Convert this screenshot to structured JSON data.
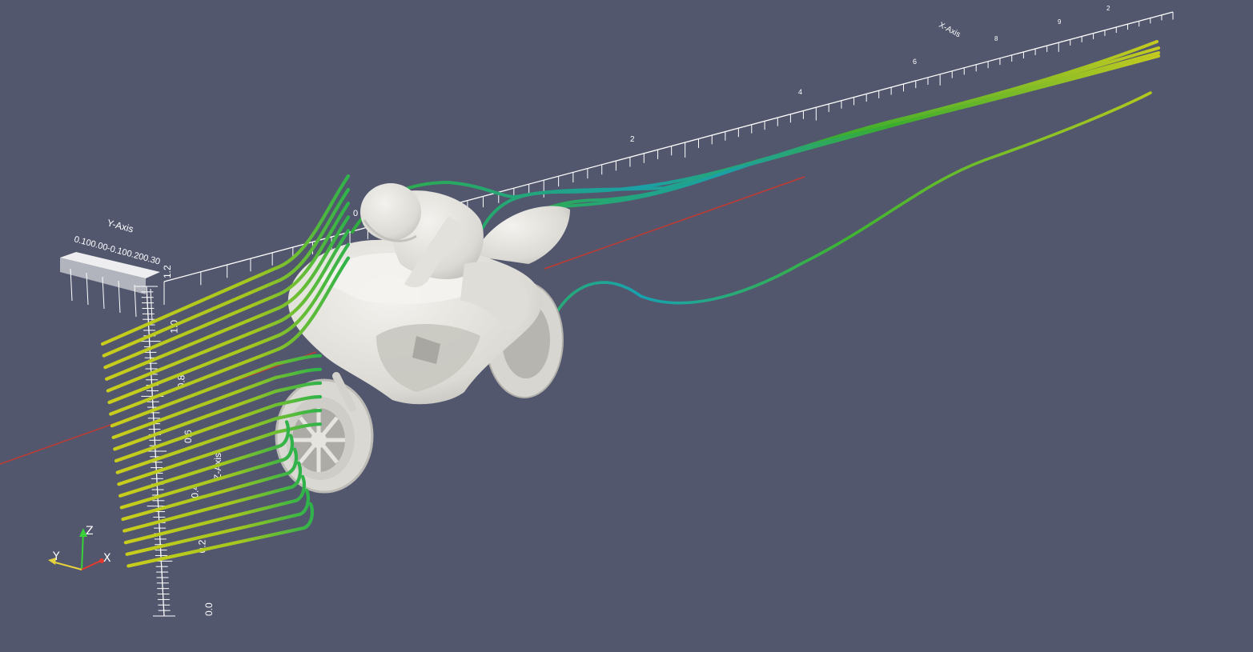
{
  "viewport": {
    "background": "#52576e",
    "model_color": "#e9e7e2",
    "x_axis_line_color": "#c23a30"
  },
  "axes": {
    "x_axis": {
      "title": "X-Axis",
      "tick_labels": [
        "0",
        "2",
        "4",
        "6",
        "8",
        "9",
        "2"
      ]
    },
    "y_axis": {
      "title": "Y-Axis",
      "tick_labels": [
        "0.10",
        "0.00",
        "-0.10",
        "0.20",
        "0.30"
      ],
      "tick_label_text": "0.100.00-0.100.200.30"
    },
    "z_axis": {
      "title": "Z-Axis",
      "tick_labels": [
        "0.0",
        "0.2",
        "0.4",
        "0.6",
        "0.8",
        "1.0",
        "1.2"
      ]
    }
  },
  "orientation_triad": {
    "x_label": "X",
    "y_label": "Y",
    "z_label": "Z",
    "x_color": "#e23b2e",
    "y_color": "#e6d23a",
    "z_color": "#38d138"
  },
  "streamlines": {
    "colormap": [
      "#d2d21c",
      "#9ccc1e",
      "#3cb43c",
      "#1aa1a8",
      "#1e6ec8"
    ]
  }
}
